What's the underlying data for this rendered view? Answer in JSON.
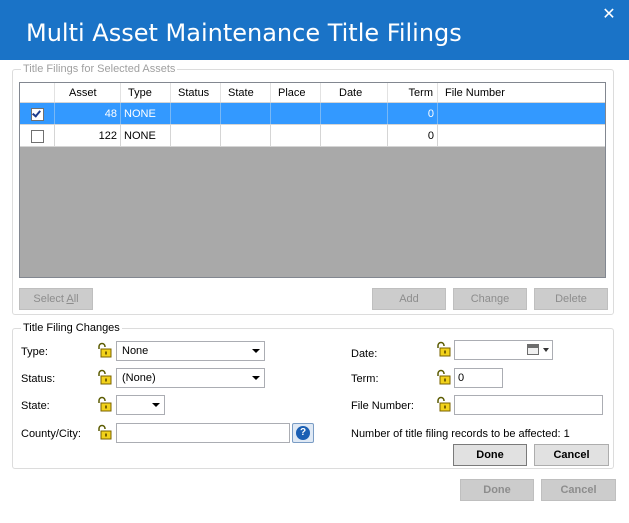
{
  "window": {
    "title": "Multi Asset Maintenance Title Filings",
    "close_glyph": "✕"
  },
  "filings_group": {
    "legend": "Title Filings for Selected Assets",
    "columns": [
      "Asset",
      "Type",
      "Status",
      "State",
      "Place",
      "Date",
      "Term",
      "File Number"
    ],
    "rows": [
      {
        "checked": true,
        "asset": "48",
        "type": "NONE",
        "status": "",
        "state": "",
        "place": "",
        "date": "",
        "term": "0",
        "file_number": ""
      },
      {
        "checked": false,
        "asset": "122",
        "type": "NONE",
        "status": "",
        "state": "",
        "place": "",
        "date": "",
        "term": "0",
        "file_number": ""
      }
    ],
    "buttons": {
      "select_all_pre": "Select ",
      "select_all_key": "A",
      "select_all_post": "ll",
      "add": "Add",
      "change": "Change",
      "delete": "Delete"
    }
  },
  "changes_group": {
    "legend": "Title Filing Changes",
    "type_label": "Type:",
    "type_value": "None",
    "status_label": "Status:",
    "status_value": "(None)",
    "state_label": "State:",
    "state_value": "",
    "county_label": "County/City:",
    "county_value": "",
    "date_label": "Date:",
    "date_value": "",
    "term_label": "Term:",
    "term_value": "0",
    "file_number_label": "File Number:",
    "file_number_value": "",
    "affected_label": "Number of title filing records to be affected:",
    "affected_count": "1",
    "done": "Done",
    "cancel": "Cancel"
  },
  "footer": {
    "done": "Done",
    "cancel": "Cancel"
  },
  "icons": {
    "lock": "lock-icon",
    "help": "help-icon",
    "calendar": "calendar-icon"
  },
  "colors": {
    "titlebar": "#1a73c7",
    "selected_row": "#3399ff",
    "grid_empty": "#a9a9a9"
  }
}
